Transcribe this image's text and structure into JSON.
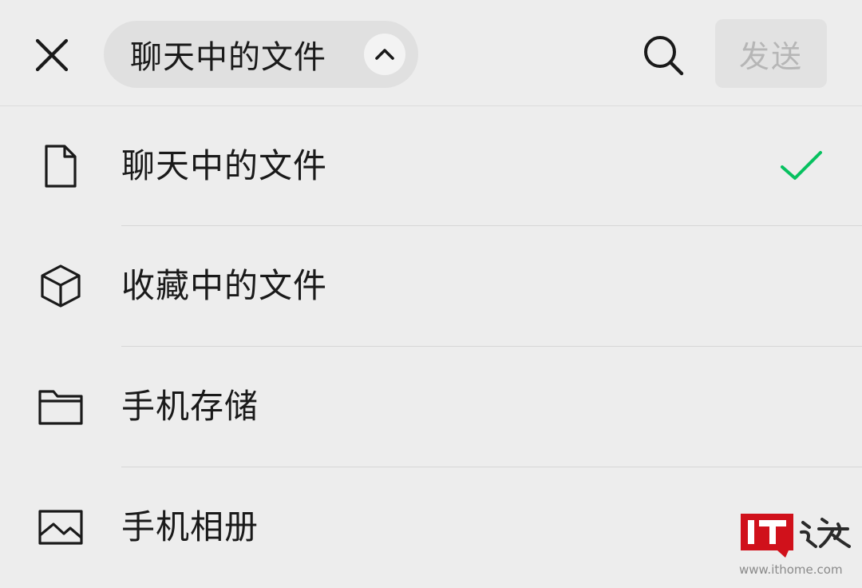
{
  "header": {
    "source_label": "聊天中的文件",
    "send_label": "发送",
    "icons": {
      "close": "close-icon",
      "dropdown": "chevron-up-icon",
      "search": "search-icon"
    }
  },
  "menu": {
    "items": [
      {
        "label": "聊天中的文件",
        "icon": "file-icon",
        "selected": true
      },
      {
        "label": "收藏中的文件",
        "icon": "cube-icon",
        "selected": false
      },
      {
        "label": "手机存储",
        "icon": "folder-icon",
        "selected": false
      },
      {
        "label": "手机相册",
        "icon": "image-icon",
        "selected": false
      }
    ]
  },
  "colors": {
    "check": "#07c160",
    "background": "#ededed",
    "send_disabled_text": "#b6b6b6",
    "watermark_red": "#d0111b"
  },
  "watermark": {
    "brand": "IT之家",
    "url": "www.ithome.com"
  }
}
